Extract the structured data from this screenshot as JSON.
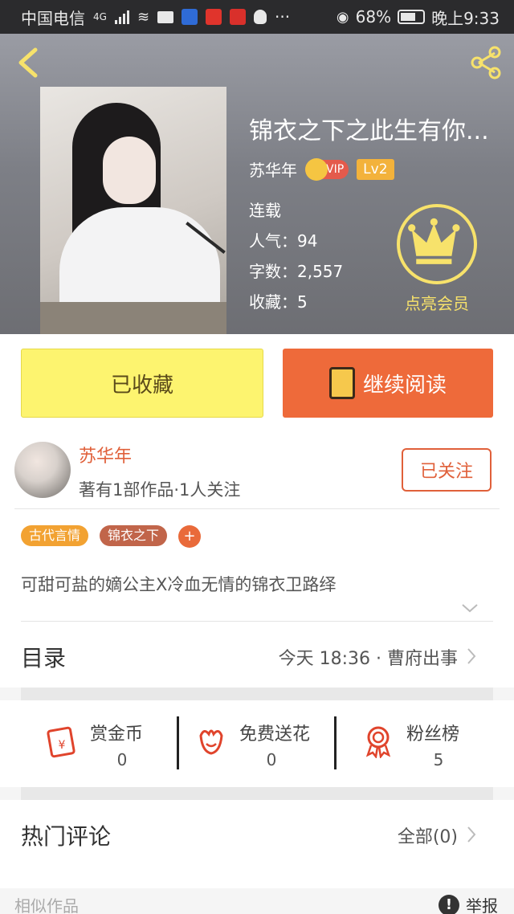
{
  "status_bar": {
    "carrier": "中国电信",
    "network": "4G",
    "battery": "68%",
    "time": "晚上9:33",
    "more": "···"
  },
  "book": {
    "title": "锦衣之下之此生有你...",
    "author": "苏华年",
    "vip_label": "VIP",
    "level": "Lv2",
    "status": "连载",
    "popularity_label": "人气：",
    "popularity": "94",
    "word_count_label": "字数：",
    "word_count": "2,557",
    "favorites_label": "收藏：",
    "favorites": "5",
    "member_label": "点亮会员",
    "colors": {
      "member_gold": "#f7e26b"
    }
  },
  "actions": {
    "favorited_label": "已收藏",
    "continue_label": "继续阅读",
    "colors": {
      "fav_bg": "#fdf46f",
      "read_bg": "#ee6a3a"
    }
  },
  "author_card": {
    "name": "苏华年",
    "works": "著有1部作品·1人关注",
    "follow_label": "已关注"
  },
  "tags": [
    "古代言情",
    "锦衣之下"
  ],
  "tag_add": "+",
  "intro": "可甜可盐的嫡公主X冷血无情的锦衣卫路绎",
  "toc": {
    "title": "目录",
    "latest": "今天 18:36 · 曹府出事"
  },
  "stats": [
    {
      "label": "赏金币",
      "value": "0",
      "icon": "red-envelope-icon"
    },
    {
      "label": "免费送花",
      "value": "0",
      "icon": "flower-icon"
    },
    {
      "label": "粉丝榜",
      "value": "5",
      "icon": "medal-icon"
    }
  ],
  "comments": {
    "title": "热门评论",
    "all_label": "全部(0)"
  },
  "footer": {
    "similar": "相似作品",
    "report": "举报",
    "report_icon": "!"
  }
}
